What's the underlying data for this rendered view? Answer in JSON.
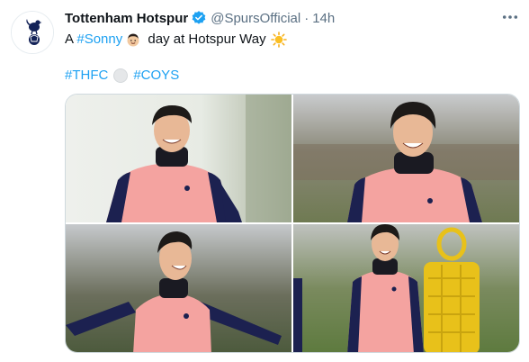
{
  "tweet": {
    "display_name": "Tottenham Hotspur",
    "handle": "@SpursOfficial",
    "separator": "·",
    "time": "14h",
    "more_icon": "more-horizontal-icon",
    "text_line1": {
      "prefix": "A ",
      "hashtag": "#Sonny",
      "suffix": " day at Hotspur Way"
    },
    "text_line2": {
      "hashtag1": "#THFC",
      "hashtag2": "#COYS"
    }
  },
  "colors": {
    "accent": "#1da1f2",
    "secondary_text": "#5b7083",
    "primary_text": "#0f1419",
    "kit_pink": "#f4a3a0",
    "kit_navy": "#1c2150"
  }
}
